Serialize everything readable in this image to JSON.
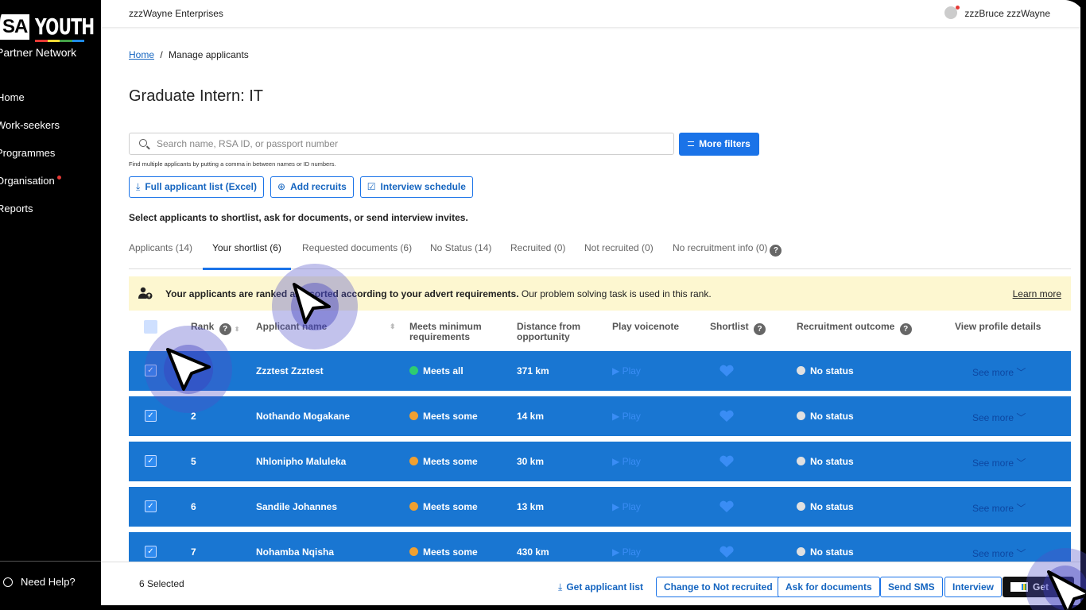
{
  "brand": {
    "logo_sa": "SA",
    "logo_youth": "YOUTH",
    "subtitle": "Partner Network",
    "stripe_colors": [
      "#e53935",
      "#fdd835",
      "#43a047",
      "#1e88e5"
    ]
  },
  "nav": {
    "items": [
      {
        "label": "Home"
      },
      {
        "label": "Work-seekers"
      },
      {
        "label": "Programmes"
      },
      {
        "label": "Organisation"
      },
      {
        "label": "Reports"
      }
    ],
    "help": "Need Help?"
  },
  "topbar": {
    "org": "zzzWayne Enterprises",
    "user": "zzzBruce zzzWayne"
  },
  "breadcrumb": {
    "home": "Home",
    "separator": "/",
    "current": "Manage applicants"
  },
  "page_title": "Graduate Intern: IT",
  "search": {
    "placeholder": "Search name, RSA ID, or passport number",
    "hint": "Find multiple applicants by putting a comma in between names or ID numbers."
  },
  "more_filters": "More filters",
  "actions": {
    "full_list": "Full applicant list (Excel)",
    "add_recruits": "Add recruits",
    "interview_schedule": "Interview schedule"
  },
  "instructions": "Select applicants to shortlist, ask for documents, or send interview invites.",
  "tabs": [
    {
      "label": "Applicants (14)"
    },
    {
      "label": "Your shortlist (6)"
    },
    {
      "label": "Requested documents (6)"
    },
    {
      "label": "No Status (14)"
    },
    {
      "label": "Recruited (0)"
    },
    {
      "label": "Not recruited (0)"
    },
    {
      "label": "No recruitment info (0)"
    }
  ],
  "banner": {
    "bold": "Your applicants are ranked and sorted according to your advert requirements.",
    "rest": " Our problem solving task is used in this rank.",
    "link": "Learn more"
  },
  "table": {
    "headers": {
      "rank": "Rank",
      "name": "Applicant name",
      "meets": "Meets minimum requirements",
      "distance": "Distance from opportunity",
      "voicenote": "Play voicenote",
      "shortlist": "Shortlist",
      "outcome": "Recruitment outcome",
      "profile": "View profile details"
    },
    "rows": [
      {
        "rank": "",
        "name": "Zzztest Zzztest",
        "meets": "Meets all",
        "distance": "371 km",
        "play": "Play",
        "status": "No status",
        "see_more": "See more"
      },
      {
        "rank": "2",
        "name": "Nothando Mogakane",
        "meets": "Meets some",
        "distance": "14 km",
        "play": "Play",
        "status": "No status",
        "see_more": "See more"
      },
      {
        "rank": "5",
        "name": "Nhlonipho Maluleka",
        "meets": "Meets some",
        "distance": "30 km",
        "play": "Play",
        "status": "No status",
        "see_more": "See more"
      },
      {
        "rank": "6",
        "name": "Sandile Johannes",
        "meets": "Meets some",
        "distance": "13 km",
        "play": "Play",
        "status": "No status",
        "see_more": "See more"
      },
      {
        "rank": "7",
        "name": "Nohamba Nqisha",
        "meets": "Meets some",
        "distance": "430 km",
        "play": "Play",
        "status": "No status",
        "see_more": "See more"
      }
    ]
  },
  "footer": {
    "selected": "6 Selected",
    "get_list": "Get applicant list",
    "not_recruited": "Change to Not recruited",
    "ask_docs": "Ask for documents",
    "send_sms": "Send SMS",
    "interview": "Interview",
    "get": "Get"
  },
  "colors": {
    "accent": "#1a73e8",
    "row_bg": "#1976d2",
    "meets_all": "#2ecc71",
    "meets_some": "#f0a030",
    "banner_bg": "#fdf7d0"
  }
}
